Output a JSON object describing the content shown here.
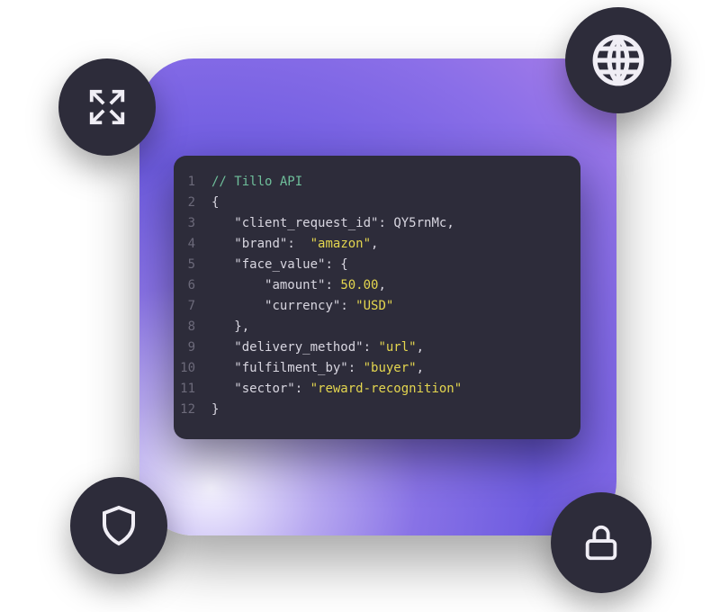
{
  "code": {
    "comment": "// Tillo API",
    "lines": [
      {
        "n": "1",
        "tokens": [
          {
            "t": "// Tillo API",
            "c": "comment"
          }
        ]
      },
      {
        "n": "2",
        "tokens": [
          {
            "t": "{",
            "c": "punc"
          }
        ]
      },
      {
        "n": "3",
        "tokens": [
          {
            "t": "   ",
            "c": "punc"
          },
          {
            "t": "\"client_request_id\"",
            "c": "key"
          },
          {
            "t": ": ",
            "c": "punc"
          },
          {
            "t": "QY5rnMc",
            "c": "plain"
          },
          {
            "t": ",",
            "c": "punc"
          }
        ]
      },
      {
        "n": "4",
        "tokens": [
          {
            "t": "   ",
            "c": "punc"
          },
          {
            "t": "\"brand\"",
            "c": "key"
          },
          {
            "t": ":  ",
            "c": "punc"
          },
          {
            "t": "\"amazon\"",
            "c": "str"
          },
          {
            "t": ",",
            "c": "punc"
          }
        ]
      },
      {
        "n": "5",
        "tokens": [
          {
            "t": "   ",
            "c": "punc"
          },
          {
            "t": "\"face_value\"",
            "c": "key"
          },
          {
            "t": ": {",
            "c": "punc"
          }
        ]
      },
      {
        "n": "6",
        "tokens": [
          {
            "t": "       ",
            "c": "punc"
          },
          {
            "t": "\"amount\"",
            "c": "key"
          },
          {
            "t": ": ",
            "c": "punc"
          },
          {
            "t": "50.00",
            "c": "num"
          },
          {
            "t": ",",
            "c": "punc"
          }
        ]
      },
      {
        "n": "7",
        "tokens": [
          {
            "t": "       ",
            "c": "punc"
          },
          {
            "t": "\"currency\"",
            "c": "key"
          },
          {
            "t": ": ",
            "c": "punc"
          },
          {
            "t": "\"USD\"",
            "c": "str"
          }
        ]
      },
      {
        "n": "8",
        "tokens": [
          {
            "t": "   },",
            "c": "punc"
          }
        ]
      },
      {
        "n": "9",
        "tokens": [
          {
            "t": "   ",
            "c": "punc"
          },
          {
            "t": "\"delivery_method\"",
            "c": "key"
          },
          {
            "t": ": ",
            "c": "punc"
          },
          {
            "t": "\"url\"",
            "c": "str"
          },
          {
            "t": ",",
            "c": "punc"
          }
        ]
      },
      {
        "n": "10",
        "tokens": [
          {
            "t": "   ",
            "c": "punc"
          },
          {
            "t": "\"fulfilment_by\"",
            "c": "key"
          },
          {
            "t": ": ",
            "c": "punc"
          },
          {
            "t": "\"buyer\"",
            "c": "str"
          },
          {
            "t": ",",
            "c": "punc"
          }
        ]
      },
      {
        "n": "11",
        "tokens": [
          {
            "t": "   ",
            "c": "punc"
          },
          {
            "t": "\"sector\"",
            "c": "key"
          },
          {
            "t": ": ",
            "c": "punc"
          },
          {
            "t": "\"reward-recognition\"",
            "c": "str"
          }
        ]
      },
      {
        "n": "12",
        "tokens": [
          {
            "t": "}",
            "c": "punc"
          }
        ]
      }
    ]
  },
  "icons": {
    "expand": "expand-icon",
    "globe": "globe-icon",
    "shield": "shield-icon",
    "lock": "lock-icon"
  },
  "colors": {
    "bubble_bg": "#2d2c3a",
    "code_bg": "#2d2c3a",
    "gradient_a": "#6e5ce0",
    "gradient_b": "#a87ee8",
    "comment": "#6fbf9b",
    "string": "#e4d64f",
    "number": "#e4d64f",
    "text": "#d8d6e0"
  }
}
